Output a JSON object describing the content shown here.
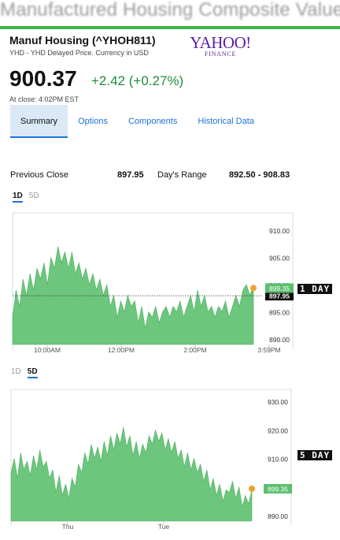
{
  "banner": "Manufactured Housing Composite Value",
  "quote": {
    "name": "Manuf Housing (^YHOH811)",
    "subtitle": "YHD - YHD Delayed Price. Currency in USD",
    "price": "900.37",
    "change": "+2.42 (+0.27%)",
    "close_time": "At close: 4:02PM EST"
  },
  "logo": {
    "main": "YAHOO!",
    "sub": "FINANCE"
  },
  "tabs": [
    "Summary",
    "Options",
    "Components",
    "Historical Data"
  ],
  "stats": {
    "prev_close_label": "Previous Close",
    "prev_close_value": "897.95",
    "days_range_label": "Day's Range",
    "days_range_value": "892.50 - 908.83"
  },
  "colors": {
    "accent": "#1a73d9",
    "fill": "#6cc67c",
    "up": "#1e8c3b",
    "marker": "#f0a030"
  },
  "chart_data": [
    {
      "type": "area",
      "range_buttons": [
        "1D",
        "5D"
      ],
      "selected": "1D",
      "tag": "1 DAY",
      "y_ticks": [
        "910.00",
        "905.00",
        "900.00",
        "895.00",
        "890.00"
      ],
      "x_ticks": [
        "10:00AM",
        "12:00PM",
        "2:00PM",
        "3:59PM"
      ],
      "ylim": [
        889,
        912
      ],
      "current_label": "899.35",
      "reference_label": "897.95",
      "reference_value": 897.95,
      "current_value": 899.35,
      "values": [
        894,
        899,
        896,
        901,
        898,
        902,
        899,
        903,
        901,
        904,
        900,
        905,
        903,
        907,
        904,
        906,
        903,
        906,
        902,
        904,
        901,
        903,
        900,
        902,
        899,
        901,
        898,
        900,
        896,
        898,
        894,
        897,
        895,
        898,
        896,
        897,
        893,
        896,
        892,
        895,
        894,
        896,
        893,
        895,
        896,
        894,
        896,
        895,
        897,
        894,
        896,
        898,
        895,
        899,
        896,
        898,
        895,
        896,
        894,
        896,
        895,
        897,
        894,
        896,
        898,
        896,
        899,
        900,
        898,
        900
      ]
    },
    {
      "type": "area",
      "range_buttons": [
        "1D",
        "5D"
      ],
      "selected": "5D",
      "tag": "5 DAY",
      "y_ticks": [
        "930.00",
        "920.00",
        "910.00",
        "900.00",
        "890.00"
      ],
      "x_ticks": [
        "Thu",
        "Tue"
      ],
      "ylim": [
        888,
        932
      ],
      "current_label": "899.35",
      "current_value": 899.35,
      "values": [
        905,
        910,
        903,
        912,
        906,
        909,
        904,
        911,
        906,
        913,
        907,
        909,
        903,
        906,
        898,
        904,
        897,
        901,
        896,
        903,
        900,
        908,
        905,
        912,
        908,
        915,
        910,
        914,
        909,
        916,
        911,
        918,
        913,
        919,
        915,
        921,
        914,
        918,
        911,
        916,
        910,
        915,
        912,
        918,
        915,
        920,
        916,
        919,
        913,
        917,
        912,
        916,
        910,
        913,
        907,
        912,
        906,
        910,
        905,
        908,
        902,
        906,
        899,
        903,
        897,
        901,
        895,
        899,
        898,
        902,
        896,
        900,
        893,
        897,
        894,
        899
      ]
    }
  ]
}
